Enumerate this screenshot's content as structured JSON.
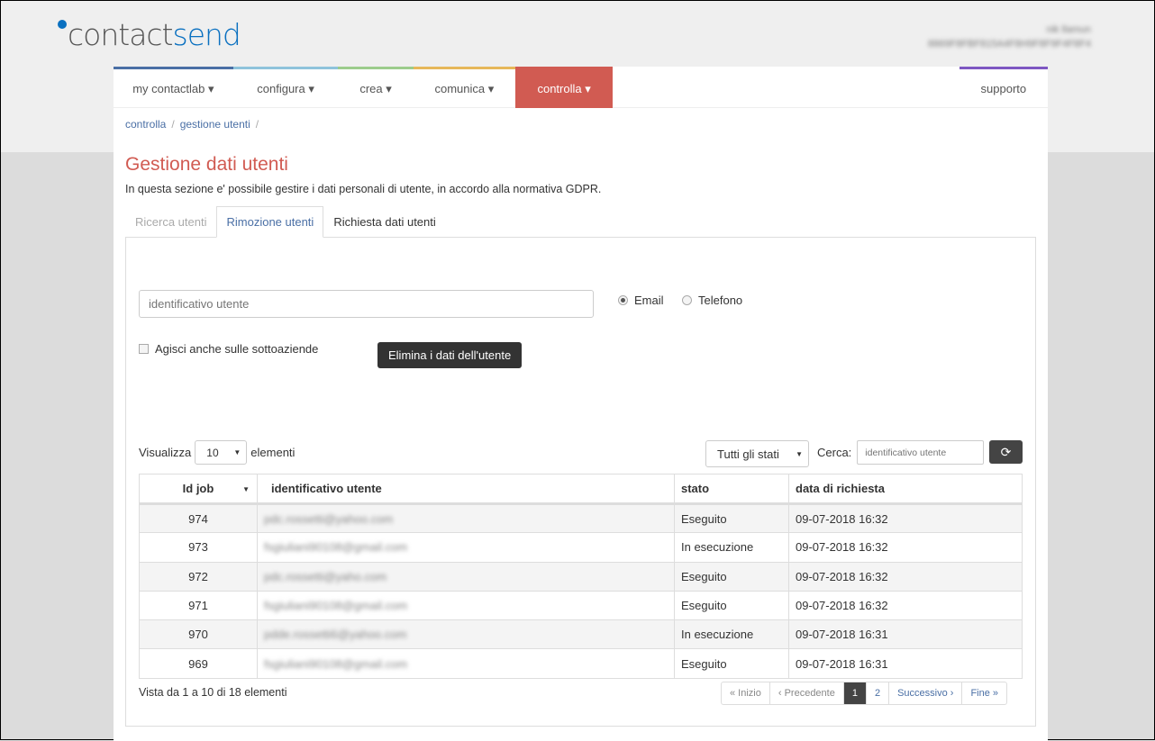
{
  "logo": {
    "part1": "contact",
    "part2": "send"
  },
  "user": {
    "name": "nik llamun",
    "info": "8869F8FBF815A4F8H9F8F9F4F8F4"
  },
  "nav": [
    {
      "label": "my contactlab ▾",
      "color": "#4a6fa5"
    },
    {
      "label": "configura ▾",
      "color": "#8ec3db"
    },
    {
      "label": "crea ▾",
      "color": "#9ccc8c"
    },
    {
      "label": "comunica ▾",
      "color": "#e7b85a"
    },
    {
      "label": "controlla ▾",
      "color": "#d15b52"
    },
    {
      "label": "supporto",
      "color": "#7e57c2"
    }
  ],
  "breadcrumb": [
    "controlla",
    "gestione utenti"
  ],
  "breadcrumb_sep": "/",
  "title": "Gestione dati utenti",
  "subtitle": "In questa sezione e' possibile gestire i dati personali di utente, in accordo alla normativa GDPR.",
  "tabs": [
    "Ricerca utenti",
    "Rimozione utenti",
    "Richiesta dati utenti"
  ],
  "form": {
    "placeholder": "identificativo utente",
    "radio_email": "Email",
    "radio_phone": "Telefono",
    "checkbox": "Agisci anche sulle sottoaziende",
    "tooltip": "Elimina i dati dell'utente"
  },
  "list": {
    "show_label": "Visualizza",
    "show_value": "10",
    "show_suffix": "elementi",
    "status_filter": "Tutti gli stati",
    "search_label": "Cerca:",
    "search_placeholder": "identificativo utente"
  },
  "table": {
    "headers": [
      "Id job",
      "identificativo utente",
      "stato",
      "data di richiesta"
    ],
    "rows": [
      [
        "974",
        "pdc.rossetti@yahoo.com",
        "Eseguito",
        "09-07-2018 16:32"
      ],
      [
        "973",
        "fsgiuliani90108@gmail.com",
        "In esecuzione",
        "09-07-2018 16:32"
      ],
      [
        "972",
        "pdc.rossetti@yaho.com",
        "Eseguito",
        "09-07-2018 16:32"
      ],
      [
        "971",
        "fsgiuliani90108@gmail.com",
        "Eseguito",
        "09-07-2018 16:32"
      ],
      [
        "970",
        "pdde.rossetti6@yahoo.com",
        "In esecuzione",
        "09-07-2018 16:31"
      ],
      [
        "969",
        "fsgiuliani90108@gmail.com",
        "Eseguito",
        "09-07-2018 16:31"
      ]
    ]
  },
  "footer": {
    "info": "Vista da 1 a 10 di 18 elementi"
  },
  "pagination": {
    "first": "« Inizio",
    "prev": "‹ Precedente",
    "pages": [
      "1",
      "2"
    ],
    "next": "Successivo ›",
    "last": "Fine »"
  }
}
